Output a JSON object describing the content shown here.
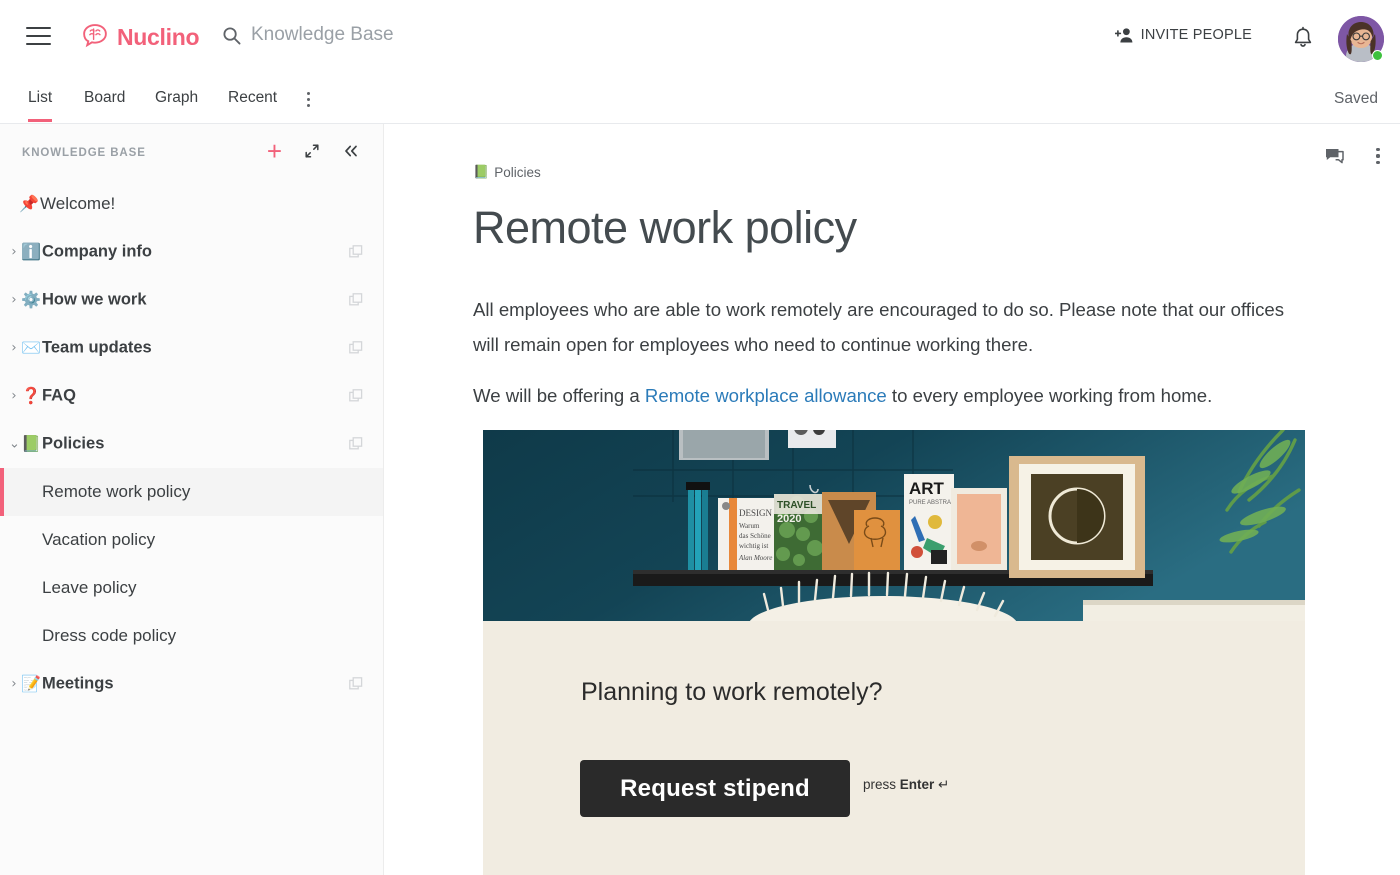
{
  "app": {
    "brand": "Nuclino",
    "brand_color": "#f2617a",
    "accent_color": "#f2617a",
    "link_color": "#2b7bb9"
  },
  "topbar": {
    "menu_icon": "hamburger-icon",
    "search_icon": "search-icon",
    "search_text": "Knowledge Base",
    "invite_label": "INVITE PEOPLE",
    "invite_icon": "add-person-icon",
    "bell_icon": "bell-icon",
    "avatar_icon": "user-avatar",
    "status": "online"
  },
  "tabs": {
    "items": [
      {
        "label": "List",
        "active": true
      },
      {
        "label": "Board",
        "active": false
      },
      {
        "label": "Graph",
        "active": false
      },
      {
        "label": "Recent",
        "active": false
      }
    ],
    "more_icon": "more-vertical-icon",
    "saved_label": "Saved"
  },
  "sidebar": {
    "title": "KNOWLEDGE BASE",
    "actions": {
      "add_icon": "plus-icon",
      "expand_icon": "expand-icon",
      "collapse_icon": "collapse-left-icon"
    },
    "items": [
      {
        "emoji": "📌",
        "label": "Welcome!",
        "chevron": "",
        "copy_icon": false,
        "pinned": true
      },
      {
        "emoji": "ℹ️",
        "label": "Company info",
        "chevron": "›",
        "copy_icon": true
      },
      {
        "emoji": "⚙️",
        "label": "How we work",
        "chevron": "›",
        "copy_icon": true
      },
      {
        "emoji": "✉️",
        "label": "Team updates",
        "chevron": "›",
        "copy_icon": true
      },
      {
        "emoji": "❓",
        "label": "FAQ",
        "chevron": "›",
        "copy_icon": true
      },
      {
        "emoji": "📗",
        "label": "Policies",
        "chevron": "⌄",
        "copy_icon": true,
        "expanded": true
      }
    ],
    "children": [
      {
        "label": "Remote work policy",
        "active": true
      },
      {
        "label": "Vacation policy",
        "active": false
      },
      {
        "label": "Leave policy",
        "active": false
      },
      {
        "label": "Dress code policy",
        "active": false
      }
    ],
    "items_after": [
      {
        "emoji": "📝",
        "label": "Meetings",
        "chevron": "›",
        "copy_icon": true
      }
    ]
  },
  "document": {
    "breadcrumb_emoji": "📗",
    "breadcrumb_label": "Policies",
    "title": "Remote work policy",
    "comment_icon": "comment-icon",
    "more_icon": "more-vertical-icon",
    "paragraph_1": "All  employees who are able to work remotely are encouraged to do so. Please note that our offices will remain open for employees who need to continue working there.",
    "paragraph_2_before": "We will be offering a ",
    "paragraph_2_link": "Remote workplace allowance",
    "paragraph_2_after": " to every employee working from home.",
    "embed": {
      "photo_alt": "shelf-with-books-and-frames-photo",
      "question": "Planning to work remotely?",
      "button_label": "Request stipend",
      "hint_prefix": "press ",
      "hint_key": "Enter",
      "hint_suffix": " ↵",
      "background_color": "#f1ece1",
      "button_color": "#2a2a2a"
    }
  }
}
